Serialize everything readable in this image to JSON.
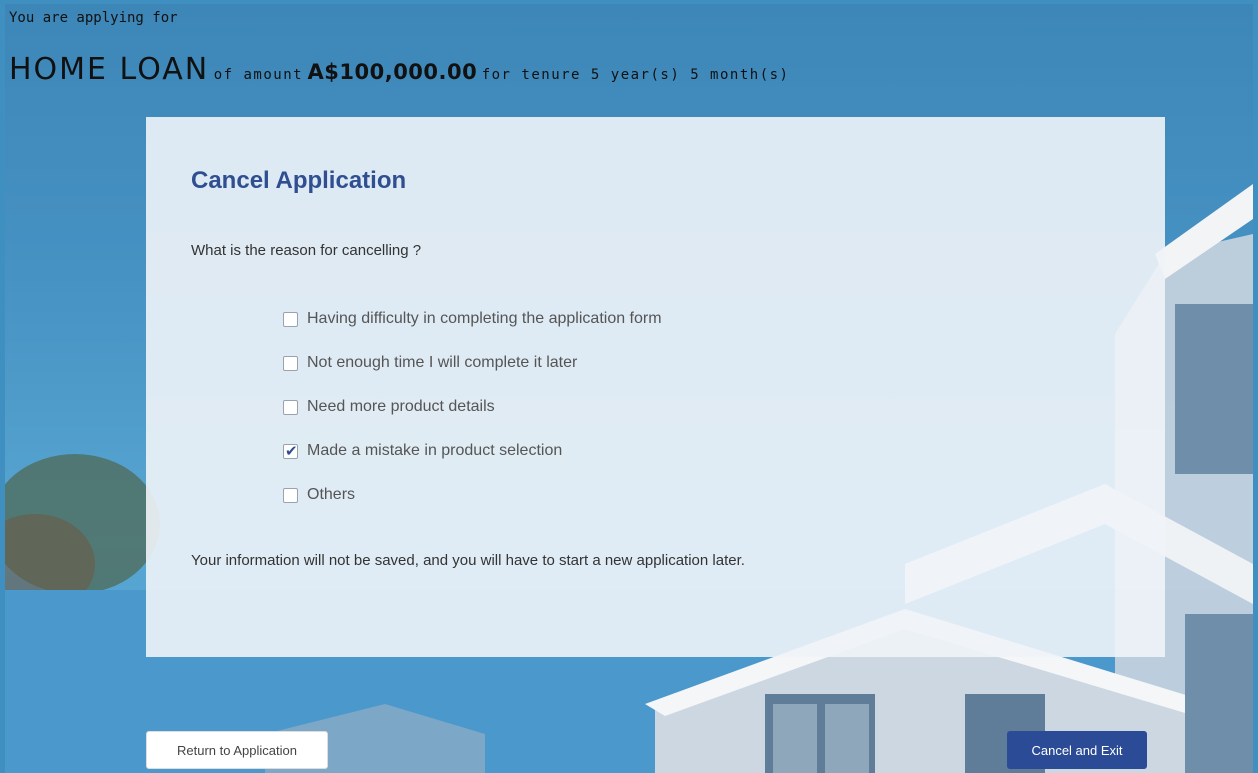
{
  "header": {
    "applying_text": "You are applying for",
    "loan_type": "HOME LOAN",
    "of_amount": "of amount",
    "amount": "A$100,000.00",
    "for_tenure": "for tenure 5 year(s) 5 month(s)"
  },
  "dialog": {
    "title": "Cancel Application",
    "question": "What is the reason for cancelling ?",
    "options": [
      {
        "label": "Having difficulty in completing the application form",
        "checked": false
      },
      {
        "label": "Not enough time I will complete it later",
        "checked": false
      },
      {
        "label": "Need more product details",
        "checked": false
      },
      {
        "label": "Made a mistake in product selection",
        "checked": true
      },
      {
        "label": "Others",
        "checked": false
      }
    ],
    "info": "Your information will not be saved, and you will have to start a new application later."
  },
  "buttons": {
    "return_label": "Return to Application",
    "cancel_label": "Cancel and Exit"
  },
  "colors": {
    "accent": "#2f4f91",
    "primary_button": "#2c4b96",
    "sky": "#4692c3"
  }
}
